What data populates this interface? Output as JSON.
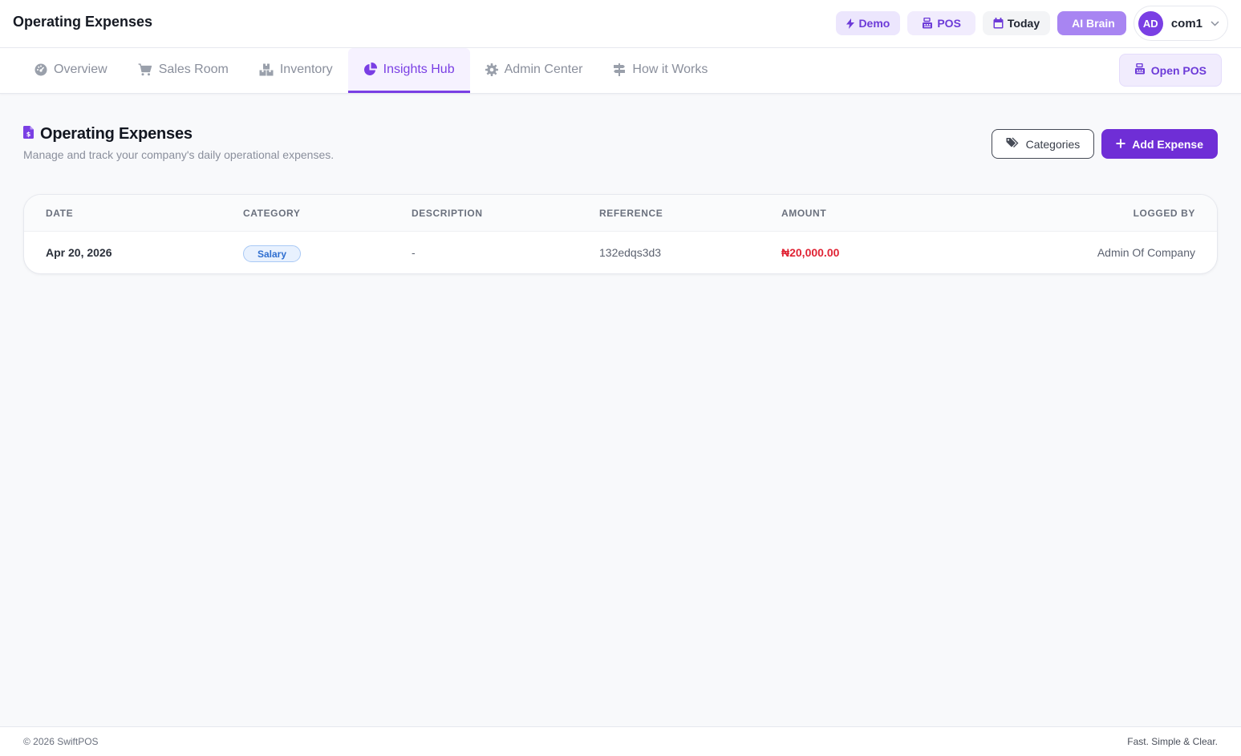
{
  "topbar": {
    "title": "Operating Expenses",
    "demo_label": "Demo",
    "pos_label": "POS",
    "today_label": "Today",
    "ai_label": "AI Brain",
    "profile": {
      "initials": "AD",
      "name": "com1"
    }
  },
  "nav": {
    "tabs": [
      {
        "label": "Overview",
        "icon": "dashboard-gauge-icon",
        "active": false
      },
      {
        "label": "Sales Room",
        "icon": "cart-icon",
        "active": false
      },
      {
        "label": "Inventory",
        "icon": "boxes-icon",
        "active": false
      },
      {
        "label": "Insights Hub",
        "icon": "pie-chart-icon",
        "active": true
      },
      {
        "label": "Admin Center",
        "icon": "gear-icon",
        "active": false
      },
      {
        "label": "How it Works",
        "icon": "signpost-icon",
        "active": false
      }
    ],
    "open_pos_label": "Open POS"
  },
  "page": {
    "title": "Operating Expenses",
    "subtitle": "Manage and track your company's daily operational expenses.",
    "categories_label": "Categories",
    "add_expense_label": "Add Expense"
  },
  "table": {
    "headers": {
      "date": "DATE",
      "category": "CATEGORY",
      "description": "DESCRIPTION",
      "reference": "REFERENCE",
      "amount": "AMOUNT",
      "logged_by": "LOGGED BY"
    },
    "rows": [
      {
        "date": "Apr 20, 2026",
        "category": "Salary",
        "description": "-",
        "reference": "132edqs3d3",
        "amount": "₦20,000.00",
        "logged_by": "Admin Of Company"
      }
    ]
  },
  "footer": {
    "copyright": "© 2026 SwiftPOS",
    "tagline": "Fast. Simple & Clear."
  },
  "colors": {
    "accent": "#7a3fe4",
    "primary_button": "#6f2ed6",
    "amount_red": "#e02435",
    "badge_blue": "#2f6fd0"
  }
}
